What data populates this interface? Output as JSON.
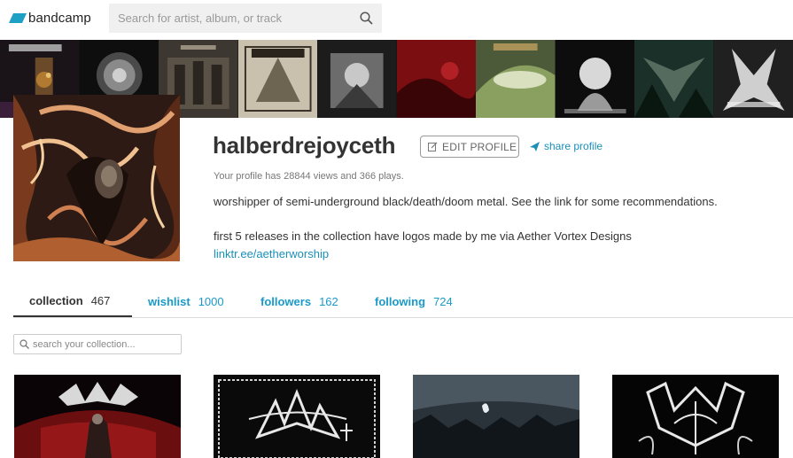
{
  "header": {
    "logo_text": "bandcamp",
    "search_placeholder": "Search for artist, album, or track",
    "brand_color": "#1da0c3"
  },
  "banner": {
    "tiles": [
      "album-cover",
      "album-cover",
      "album-cover",
      "album-cover",
      "album-cover",
      "album-cover",
      "album-cover",
      "album-cover",
      "album-cover",
      "album-cover"
    ]
  },
  "profile": {
    "username": "halberdrejoyceth",
    "edit_label": "EDIT PROFILE",
    "share_label": "share profile",
    "stats_text": "Your profile has 28844 views and 366 plays.",
    "bio_line1": "worshipper of semi-underground black/death/doom metal. See the link for some recommendations.",
    "bio_line2": "first 5 releases in the collection have logos made by me via Aether Vortex Designs",
    "link_text": "linktr.ee/aetherworship"
  },
  "tabs": [
    {
      "label": "collection",
      "count": "467",
      "active": true
    },
    {
      "label": "wishlist",
      "count": "1000",
      "active": false
    },
    {
      "label": "followers",
      "count": "162",
      "active": false
    },
    {
      "label": "following",
      "count": "724",
      "active": false
    }
  ],
  "collection": {
    "search_placeholder": "search your collection...",
    "items": [
      "album-cover-1",
      "album-cover-2",
      "album-cover-3",
      "album-cover-4"
    ]
  },
  "colors": {
    "link": "#1a8fb8",
    "tab_link": "#1a9ac8",
    "text": "#333333"
  }
}
